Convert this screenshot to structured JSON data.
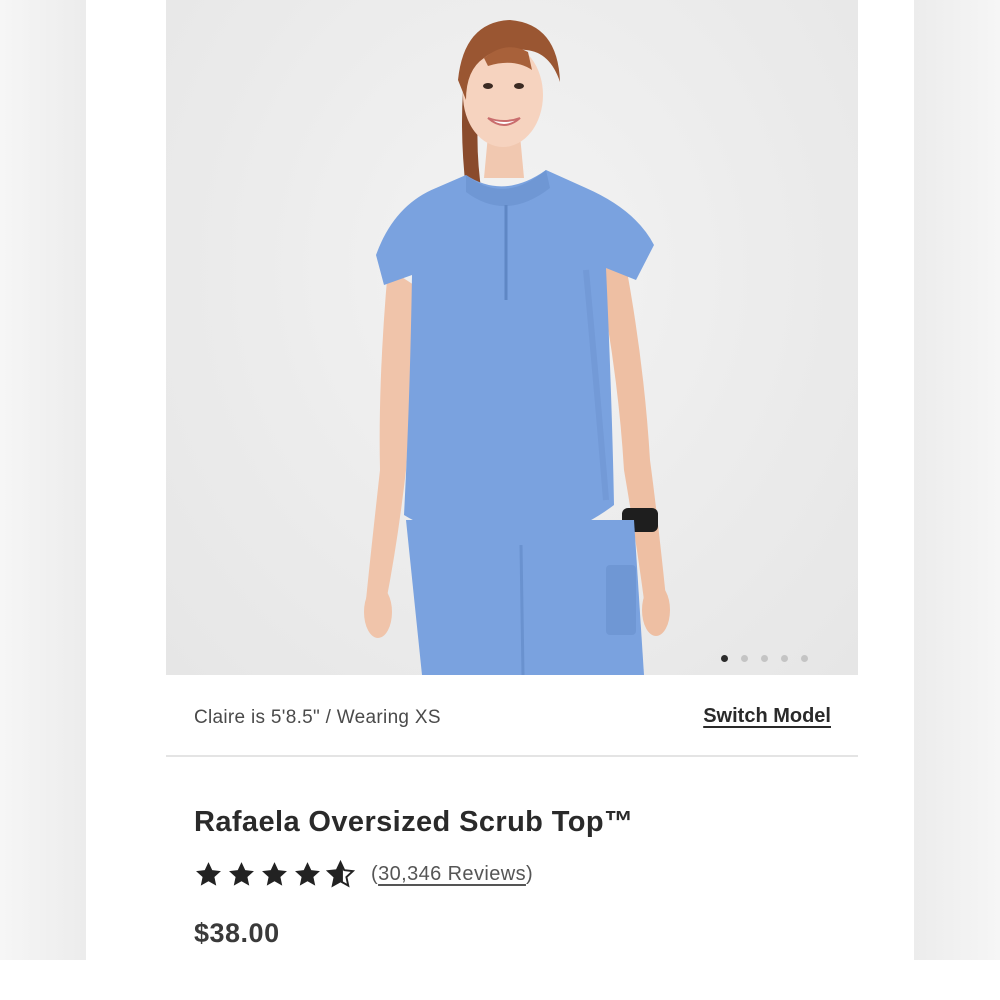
{
  "product_image": {
    "description_icon": "photo",
    "carousel": {
      "total": 5,
      "active_index": 0
    }
  },
  "model_row": {
    "info": "Claire is 5'8.5\" / Wearing XS",
    "switch_label": "Switch Model"
  },
  "product": {
    "title": "Rafaela Oversized Scrub Top™",
    "rating": 4.5,
    "reviews_open": "(",
    "reviews_label": "30,346 Reviews",
    "reviews_close": ")",
    "price": "$38.00"
  },
  "colors": {
    "scrub": "#7aa2df",
    "text": "#2a2a2a"
  }
}
